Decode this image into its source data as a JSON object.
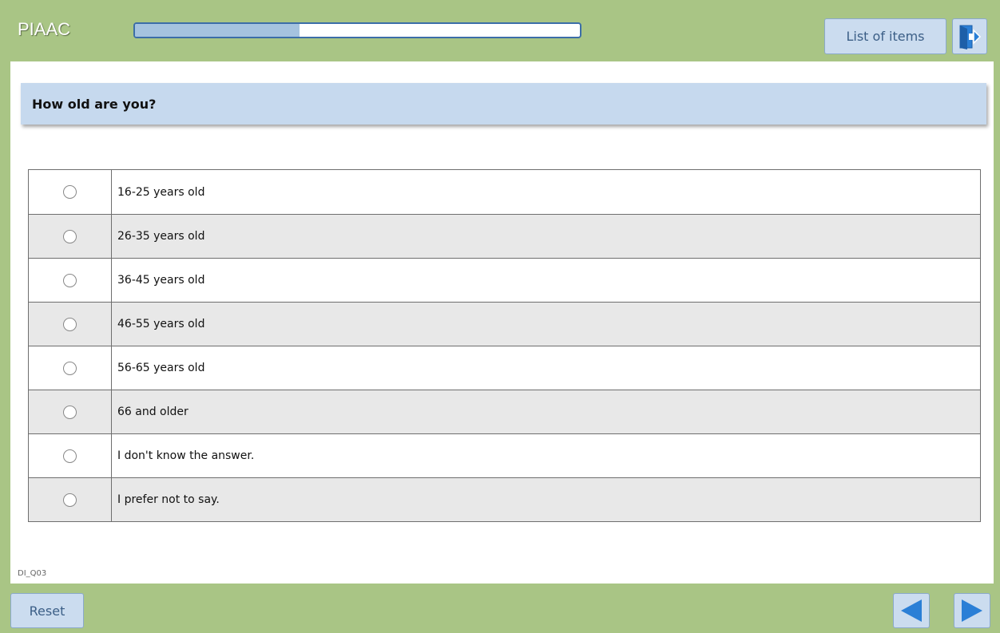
{
  "header": {
    "title": "PIAAC",
    "progress_fraction": 0.37,
    "list_button_label": "List of items",
    "exit_icon": "exit-door-icon"
  },
  "question": {
    "text": "How old are you?"
  },
  "options": [
    {
      "label": "16-25 years old"
    },
    {
      "label": "26-35 years old"
    },
    {
      "label": "36-45 years old"
    },
    {
      "label": "46-55 years old"
    },
    {
      "label": "56-65 years old"
    },
    {
      "label": "66 and older"
    },
    {
      "label": "I don't know the answer."
    },
    {
      "label": "I prefer not to say."
    }
  ],
  "footer": {
    "item_id": "DI_Q03",
    "reset_label": "Reset",
    "prev_icon": "arrow-left-icon",
    "next_icon": "arrow-right-icon"
  },
  "colors": {
    "frame_green": "#a9c585",
    "button_blue": "#cbdcef",
    "question_blue": "#c6d9ee",
    "icon_blue": "#2b7fd6",
    "progress_border": "#3c6ea8",
    "progress_fill": "#a5c3df"
  }
}
